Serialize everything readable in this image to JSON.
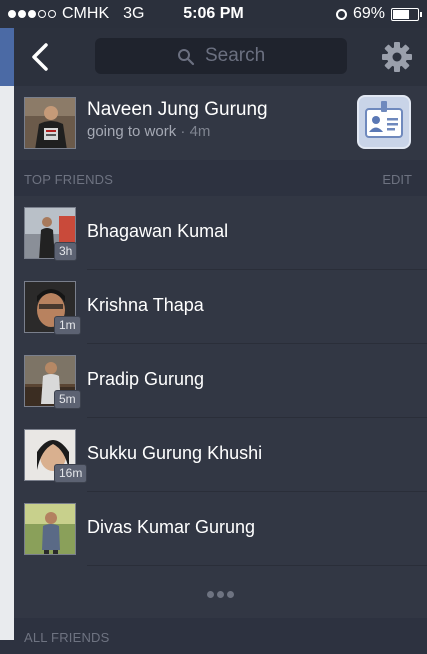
{
  "status_bar": {
    "carrier": "CMHK",
    "network": "3G",
    "time": "5:06 PM",
    "battery": "69%",
    "battery_level": 0.69,
    "signal_dots_filled": 3,
    "signal_dots_total": 5
  },
  "search": {
    "placeholder": "Search"
  },
  "profile": {
    "name": "Naveen Jung Gurung",
    "status": "going to work",
    "separator": " · ",
    "time": "4m"
  },
  "sections": {
    "top_friends": {
      "title": "TOP FRIENDS",
      "edit_label": "EDIT"
    },
    "all_friends": {
      "title": "ALL FRIENDS"
    }
  },
  "friends": [
    {
      "name": "Bhagawan Kumal",
      "badge": "3h"
    },
    {
      "name": "Krishna Thapa",
      "badge": "1m"
    },
    {
      "name": "Pradip Gurung",
      "badge": "5m"
    },
    {
      "name": "Sukku Gurung Khushi",
      "badge": "16m"
    },
    {
      "name": "Divas Kumar Gurung",
      "badge": ""
    }
  ],
  "colors": {
    "panel": "#323744",
    "topbar": "#2c313d",
    "section_text": "#6e7381",
    "badge_bg": "#5c6272",
    "feed_blue": "#4b6aa5"
  },
  "icons": {
    "back": "chevron-left-icon",
    "search": "search-icon",
    "settings": "gear-icon",
    "profile_action": "id-badge-icon",
    "more": "more-dots-icon"
  }
}
